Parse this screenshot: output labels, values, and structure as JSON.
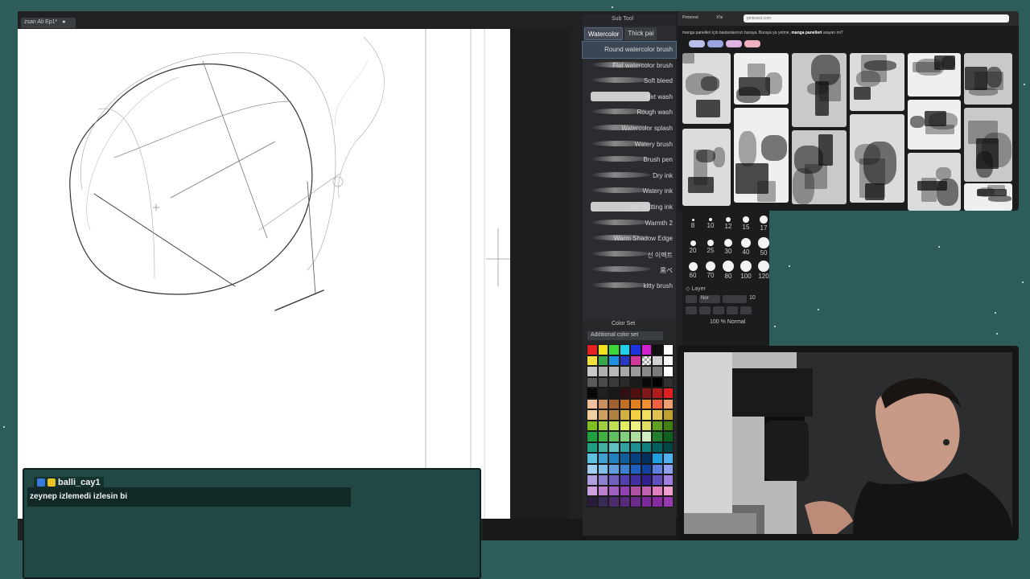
{
  "document": {
    "tab_title": "zsan Ali Ep1*",
    "tab_close": "●"
  },
  "subtool": {
    "header": "Sub Tool",
    "tabs": [
      "Watercolor",
      "Thick pai"
    ],
    "brushes": [
      {
        "label": "Round watercolor brush",
        "selected": true
      },
      {
        "label": "Flat watercolor brush",
        "selected": false
      },
      {
        "label": "Soft bleed",
        "selected": false
      },
      {
        "label": "Wet wash",
        "selected": false
      },
      {
        "label": "Rough wash",
        "selected": false
      },
      {
        "label": "Watercolor splash",
        "selected": false
      },
      {
        "label": "Watery brush",
        "selected": false
      },
      {
        "label": "Brush pen",
        "selected": false
      },
      {
        "label": "Dry ink",
        "selected": false
      },
      {
        "label": "Watery ink",
        "selected": false
      },
      {
        "label": "Wet blotting ink",
        "selected": false
      },
      {
        "label": "Warmth 2",
        "selected": false
      },
      {
        "label": "Warm Shadow Edge",
        "selected": false
      },
      {
        "label": "선 이펙트",
        "selected": false
      },
      {
        "label": "黒ペ",
        "selected": false
      },
      {
        "label": "kitty brush",
        "selected": false
      }
    ]
  },
  "color_set": {
    "header": "Color Set",
    "dropdown": "Additional color set",
    "swatches": [
      "#e52222",
      "#f2e21b",
      "#3ad63a",
      "#20d0e8",
      "#2233e0",
      "#d020d0",
      "#101010",
      "#ffffff",
      "#f0e040",
      "#3aa84a",
      "#2090e0",
      "#2838c0",
      "#d03a9a",
      "checker",
      "#d0d0d0",
      "#f8f8f8",
      "#c8c8c8",
      "#b0b0b0",
      "#b8b8b8",
      "#a8a8a8",
      "#9a9a9a",
      "#8a8a8a",
      "#7a7a7a",
      "#ffffff",
      "#5a5a5a",
      "#4a4a4a",
      "#3a3a3a",
      "#2a2a2a",
      "#1a1a1a",
      "#0a0a0a",
      "#000000",
      "#303030",
      "#080808",
      "#202020",
      "#181818",
      "#301010",
      "#501010",
      "#801818",
      "#b01c1c",
      "#e02020",
      "#f0c0a0",
      "#c89060",
      "#a06030",
      "#c07020",
      "#e08020",
      "#f09030",
      "#f06040",
      "#f0a070",
      "#f0d0a0",
      "#d0a060",
      "#b08040",
      "#d0b040",
      "#f0d040",
      "#f0e060",
      "#e0c050",
      "#c0a030",
      "#80c020",
      "#a0d040",
      "#c0e050",
      "#e0f060",
      "#f0f080",
      "#e0e060",
      "#60a020",
      "#408010",
      "#20a040",
      "#40b040",
      "#60c060",
      "#80d080",
      "#b0e0a0",
      "#d0f0c0",
      "#208030",
      "#106020",
      "#20a080",
      "#40b0a0",
      "#60c0c0",
      "#30a0a0",
      "#209090",
      "#108080",
      "#006060",
      "#004848",
      "#60c0e0",
      "#40a0d0",
      "#2080c0",
      "#1060a0",
      "#084080",
      "#043060",
      "#20a0e0",
      "#50b0f0",
      "#a0d0f0",
      "#80c0e8",
      "#60a0e0",
      "#4080d0",
      "#2060c0",
      "#1040a0",
      "#6080e0",
      "#90a0f0",
      "#b0a0e0",
      "#9080d0",
      "#7060c0",
      "#5040b0",
      "#4030a0",
      "#302090",
      "#6050c0",
      "#a080e0",
      "#d0a0e0",
      "#c080d0",
      "#a060c0",
      "#9040b0",
      "#b050a0",
      "#c060b0",
      "#e080c0",
      "#f0a0d0",
      "#2a1a3a",
      "#3a2a5a",
      "#4a2a6a",
      "#5a2a7a",
      "#6a2a8a",
      "#7a2a9a",
      "#8a2aa0",
      "#9a3ab0"
    ]
  },
  "brush_sizes": {
    "rows": [
      [
        "8",
        "10",
        "12",
        "15",
        "17"
      ],
      [
        "20",
        "25",
        "30",
        "40",
        "50"
      ],
      [
        "60",
        "70",
        "80",
        "100",
        "120"
      ]
    ],
    "layer_label": "Layer",
    "blend_mode": "Nor",
    "opacity_value": "10",
    "layer_row": "100 % Normal"
  },
  "browser": {
    "tab1": "Pinterest",
    "tab2": "X'te",
    "address": "pinterest.com",
    "page_text_prefix": "manga panelleri için bastaslarınızı buraya. Buraya ya yetme, ",
    "page_text_bold": "manga panelleri",
    "page_text_suffix": " arayan mi?"
  },
  "chat": {
    "username": "balli_cay1",
    "message": "zeynep izlemedi izlesin bi",
    "badge_colors": [
      "#3a7ad8",
      "#e8c020"
    ]
  },
  "colors": {
    "background": "#2d5c5a",
    "chat_bg": "#224846",
    "selection": "#3b4654"
  },
  "icons": [
    "shield-icon",
    "sword-icon",
    "eraser-icon",
    "layer-icon",
    "checker-icon",
    "brush-icon"
  ]
}
